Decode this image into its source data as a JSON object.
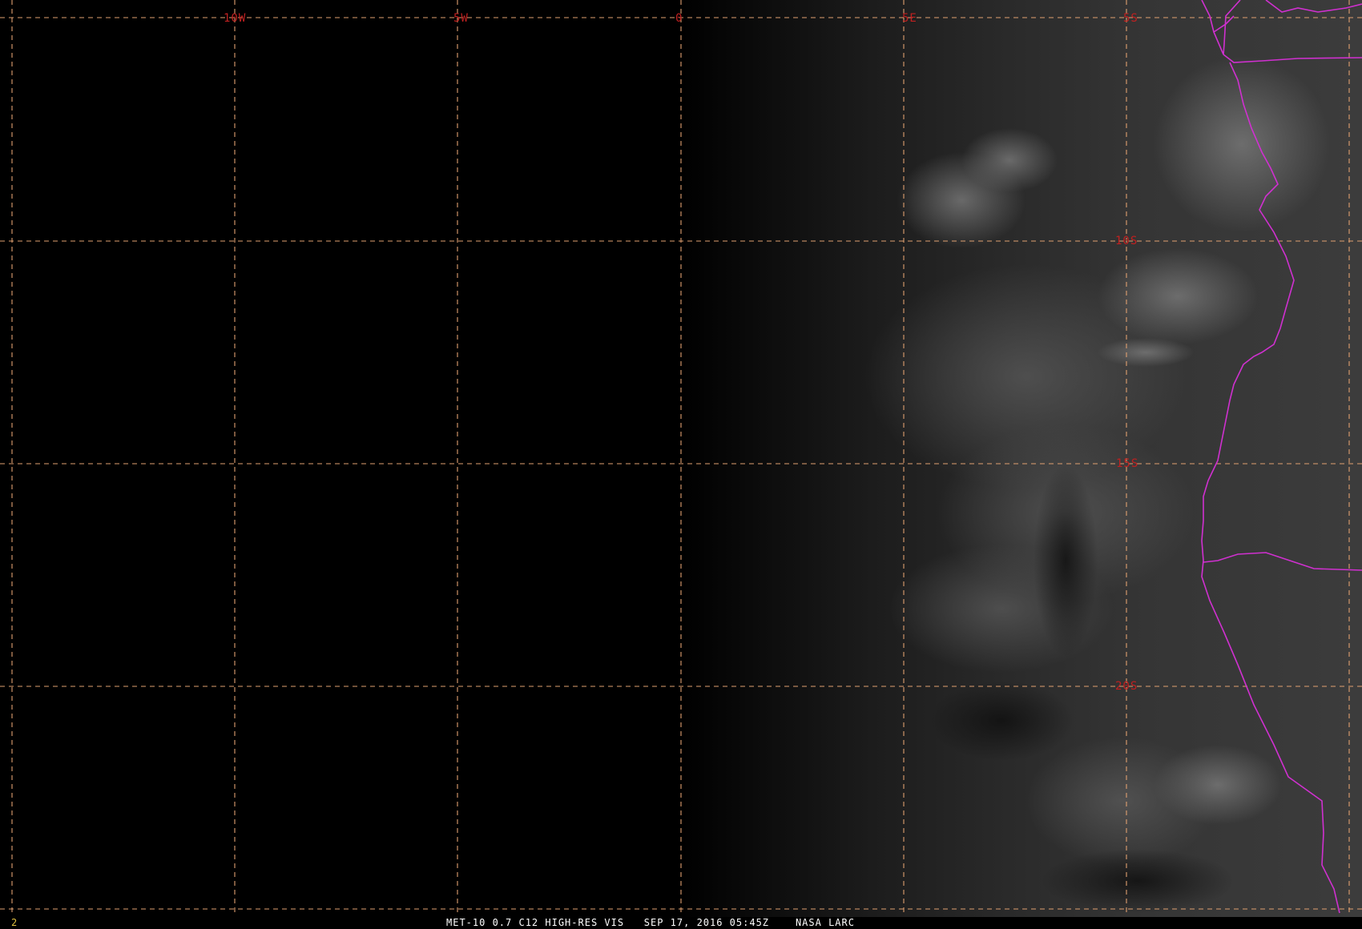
{
  "map": {
    "longitude_labels": [
      "10W",
      "5W",
      "0",
      "5E"
    ],
    "latitude_labels": [
      "5S",
      "10S",
      "15S",
      "20S"
    ],
    "colors": {
      "background": "#000000",
      "grid": "#e0a070",
      "grid_label": "#c02020",
      "political_borders": "#d030d0",
      "caption_text": "#ffffff",
      "frame_number": "#e0c040"
    }
  },
  "footer": {
    "frame_number": "2",
    "satellite": "MET-10 0.7 C12 HIGH-RES VIS",
    "datetime": "SEP 17, 2016 05:45Z",
    "credit": "NASA LARC"
  }
}
